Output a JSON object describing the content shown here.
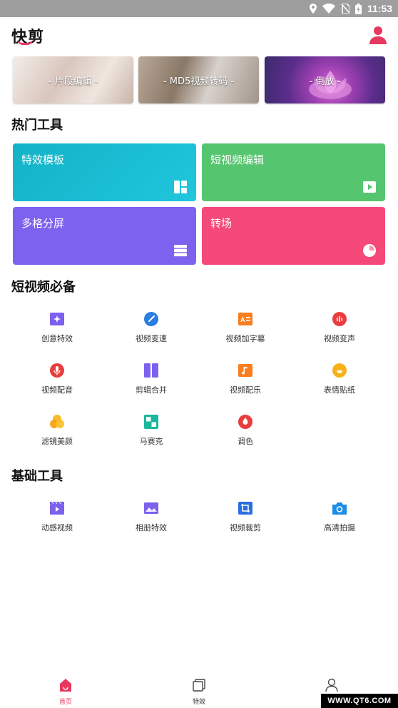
{
  "status": {
    "time": "11:53"
  },
  "header": {
    "app_title": "快剪"
  },
  "banners": [
    {
      "label": "- 片段编辑 -"
    },
    {
      "label": "- MD5视频转码 -"
    },
    {
      "label": "- 倒放 -"
    }
  ],
  "sections": {
    "hot_tools": "热门工具",
    "short_video": "短视频必备",
    "basic_tools": "基础工具"
  },
  "hot_tools": [
    {
      "label": "特效模板",
      "color": "#1bbcd2"
    },
    {
      "label": "短视频编辑",
      "color": "#55c56f"
    },
    {
      "label": "多格分屏",
      "color": "#7c62ee"
    },
    {
      "label": "转场",
      "color": "#f5497a"
    }
  ],
  "short_video_tools": [
    {
      "label": "创意特效",
      "icon": "sparkle-icon"
    },
    {
      "label": "视频变速",
      "icon": "speed-icon"
    },
    {
      "label": "视频加字幕",
      "icon": "subtitle-icon"
    },
    {
      "label": "视频变声",
      "icon": "voice-change-icon"
    },
    {
      "label": "视频配音",
      "icon": "microphone-icon"
    },
    {
      "label": "剪辑合并",
      "icon": "merge-icon"
    },
    {
      "label": "视频配乐",
      "icon": "music-icon"
    },
    {
      "label": "表情贴纸",
      "icon": "sticker-icon"
    },
    {
      "label": "滤镜美颜",
      "icon": "filter-icon"
    },
    {
      "label": "马赛克",
      "icon": "mosaic-icon"
    },
    {
      "label": "调色",
      "icon": "color-drop-icon"
    }
  ],
  "basic_tools": [
    {
      "label": "动感视频",
      "icon": "clapper-icon"
    },
    {
      "label": "相册特效",
      "icon": "album-icon"
    },
    {
      "label": "视频裁剪",
      "icon": "crop-icon"
    },
    {
      "label": "高清拍摄",
      "icon": "camera-icon"
    }
  ],
  "bottom_nav": [
    {
      "label": "首页",
      "icon": "home-icon",
      "active": true
    },
    {
      "label": "特效",
      "icon": "effects-icon",
      "active": false
    },
    {
      "label": "",
      "icon": "user-icon",
      "active": false
    }
  ],
  "watermark": "WWW.QT6.COM",
  "colors": {
    "accent": "#e6395f",
    "statusbar": "#9e9e9e"
  }
}
